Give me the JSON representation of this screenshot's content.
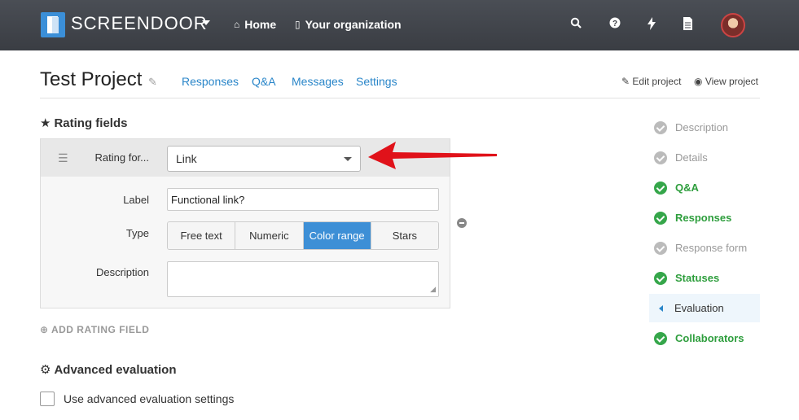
{
  "nav": {
    "brand": "SCREENDOOR",
    "home": "Home",
    "organization": "Your organization",
    "icons": [
      "search-icon",
      "help-icon",
      "bolt-icon",
      "document-icon"
    ]
  },
  "project": {
    "title": "Test Project",
    "tabs": [
      "Responses",
      "Q&A",
      "Messages",
      "Settings"
    ],
    "edit_project": "Edit project",
    "view_project": "View project"
  },
  "rating_fields": {
    "heading": "Rating fields",
    "rating_for_label": "Rating for...",
    "rating_for_value": "Link",
    "label_label": "Label",
    "label_value": "Functional link?",
    "type_label": "Type",
    "type_options": [
      "Free text",
      "Numeric",
      "Color range",
      "Stars"
    ],
    "type_selected": "Color range",
    "description_label": "Description",
    "description_value": "",
    "add_field": "ADD RATING FIELD"
  },
  "advanced": {
    "heading": "Advanced evaluation",
    "checkbox_label": "Use advanced evaluation settings",
    "checked": false
  },
  "steps": [
    {
      "label": "Description",
      "state": "todo"
    },
    {
      "label": "Details",
      "state": "todo"
    },
    {
      "label": "Q&A",
      "state": "done"
    },
    {
      "label": "Responses",
      "state": "done"
    },
    {
      "label": "Response form",
      "state": "todo"
    },
    {
      "label": "Statuses",
      "state": "done"
    },
    {
      "label": "Evaluation",
      "state": "current"
    },
    {
      "label": "Collaborators",
      "state": "done"
    }
  ],
  "colors": {
    "accent": "#2a86c9",
    "done": "#35a64a",
    "arrow": "#e0121a"
  }
}
